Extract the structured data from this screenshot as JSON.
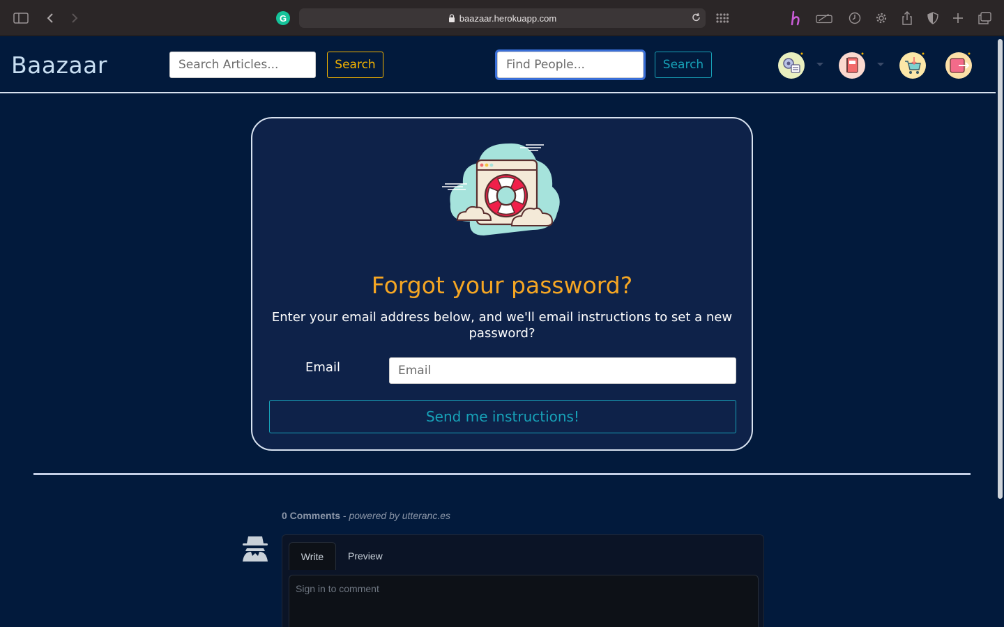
{
  "browser": {
    "url": "baazaar.herokuapp.com"
  },
  "navbar": {
    "brand": "Baazaar",
    "article_search_placeholder": "Search Articles...",
    "article_search_button": "Search",
    "people_search_placeholder": "Find People...",
    "people_search_button": "Search"
  },
  "card": {
    "title": "Forgot your password?",
    "subtitle": "Enter your email address below, and we'll email instructions to set a new password?",
    "email_label": "Email",
    "email_placeholder": "Email",
    "submit_label": "Send me instructions!"
  },
  "comments": {
    "count": "0 Comments",
    "separator": " - ",
    "powered_by": "powered by utteranc.es",
    "tab_write": "Write",
    "tab_preview": "Preview",
    "placeholder": "Sign in to comment"
  },
  "colors": {
    "page_bg": "#021a3c",
    "card_bg": "#0e2249",
    "accent_yellow": "#f5b400",
    "accent_teal": "#17a2b8",
    "title_orange": "#f5a623"
  }
}
